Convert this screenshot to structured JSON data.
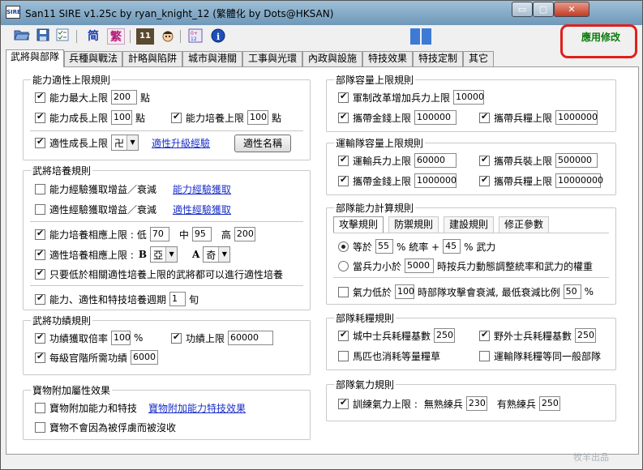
{
  "window": {
    "title": "San11 SIRE v1.25c by ryan_knight_12 (繁體化 by Dots@HKSAN)",
    "icon_label": "SIRE",
    "minimize_label": "▭",
    "maximize_label": "▢",
    "close_label": "✕"
  },
  "toolbar": {
    "simplified_label": "简",
    "traditional_label": "繁",
    "apply_label": "應用修改",
    "calendar_label": "11",
    "info_label": "i",
    "icons": [
      "folder-open-icon",
      "save-icon",
      "checklist-icon",
      "calendar-icon",
      "character-icon",
      "calculator-icon",
      "info-icon"
    ]
  },
  "tabs": [
    "武將與部隊",
    "兵種與戰法",
    "計略與陷阱",
    "城市與港關",
    "工事與光環",
    "內政與設施",
    "特技效果",
    "特技定制",
    "其它"
  ],
  "left": {
    "ability_limit": {
      "title": "能力適性上限規則",
      "max_label": "能力最大上限",
      "max_value": "200",
      "max_unit": "點",
      "growth_label": "能力成長上限",
      "growth_value": "100",
      "growth_unit": "點",
      "train_label": "能力培養上限",
      "train_value": "100",
      "train_unit": "點",
      "apt_growth_label": "適性成長上限",
      "apt_growth_value": "卍",
      "apt_link": "適性升級經驗",
      "apt_name_button": "適性名稱"
    },
    "training": {
      "title": "武將培養規則",
      "ability_exp_label": "能力經驗獲取增益／衰減",
      "ability_exp_link": "能力經驗獲取",
      "apt_exp_label": "適性經驗獲取增益／衰減",
      "apt_exp_link": "適性經驗獲取",
      "ability_relative_label": "能力培養相應上限 :",
      "low_label": "低",
      "low_value": "70",
      "mid_label": "中",
      "mid_value": "95",
      "high_label": "高",
      "high_value": "200",
      "apt_relative_label": "適性培養相應上限 :",
      "b_label": "B",
      "b_value": "亞",
      "a_label": "A",
      "a_value": "奇",
      "only_low_label": "只要低於相關適性培養上限的武將都可以進行適性培養",
      "cycle_label": "能力、適性和特技培養週期",
      "cycle_value": "1",
      "cycle_unit": "旬"
    },
    "merit": {
      "title": "武將功績規則",
      "rate_label": "功績獲取倍率",
      "rate_value": "100",
      "rate_unit": "%",
      "limit_label": "功績上限",
      "limit_value": "60000",
      "rank_label": "每級官階所需功績",
      "rank_value": "6000"
    },
    "treasure": {
      "title": "寶物附加屬性效果",
      "attr_label": "寶物附加能力和特技",
      "attr_link": "寶物附加能力特技效果",
      "no_lose_label": "寶物不會因為被俘虜而被沒收"
    }
  },
  "right": {
    "unit_cap": {
      "title": "部隊容量上限規則",
      "reform_label": "軍制改革增加兵力上限",
      "reform_value": "10000",
      "gold_label": "攜帶金錢上限",
      "gold_value": "100000",
      "food_label": "攜帶兵糧上限",
      "food_value": "1000000"
    },
    "transport_cap": {
      "title": "運輸隊容量上限規則",
      "troop_label": "運輸兵力上限",
      "troop_value": "60000",
      "weapon_label": "攜帶兵裝上限",
      "weapon_value": "500000",
      "gold_label": "攜帶金錢上限",
      "gold_value": "1000000",
      "food_label": "攜帶兵糧上限",
      "food_value": "10000000"
    },
    "calc": {
      "title": "部隊能力計算規則",
      "subtabs": [
        "攻擊規則",
        "防禦規則",
        "建設規則",
        "修正參數"
      ],
      "eq_label": "等於",
      "eq_lead_value": "55",
      "eq_lead_unit": "% 統率 +",
      "eq_war_value": "45",
      "eq_war_unit": "% 武力",
      "below_label": "當兵力小於",
      "below_value": "5000",
      "below_desc": "時按兵力動態調整統率和武力的權重",
      "morale_label": "氣力低於",
      "morale_value": "100",
      "morale_desc": "時部隊攻擊會衰減, 最低衰減比例",
      "morale_min_value": "50",
      "morale_min_unit": "%"
    },
    "food": {
      "title": "部隊耗糧規則",
      "city_label": "城中士兵耗糧基數",
      "city_value": "250",
      "field_label": "野外士兵耗糧基數",
      "field_value": "250",
      "horse_label": "馬匹也消耗等量糧草",
      "transport_label": "運輸隊耗糧等同一般部隊"
    },
    "morale": {
      "title": "部隊氣力規則",
      "train_label": "訓練氣力上限 :",
      "untrained_label": "無熟練兵",
      "untrained_value": "230",
      "trained_label": "有熟練兵",
      "trained_value": "250"
    }
  },
  "watermark": "牧羊出品"
}
